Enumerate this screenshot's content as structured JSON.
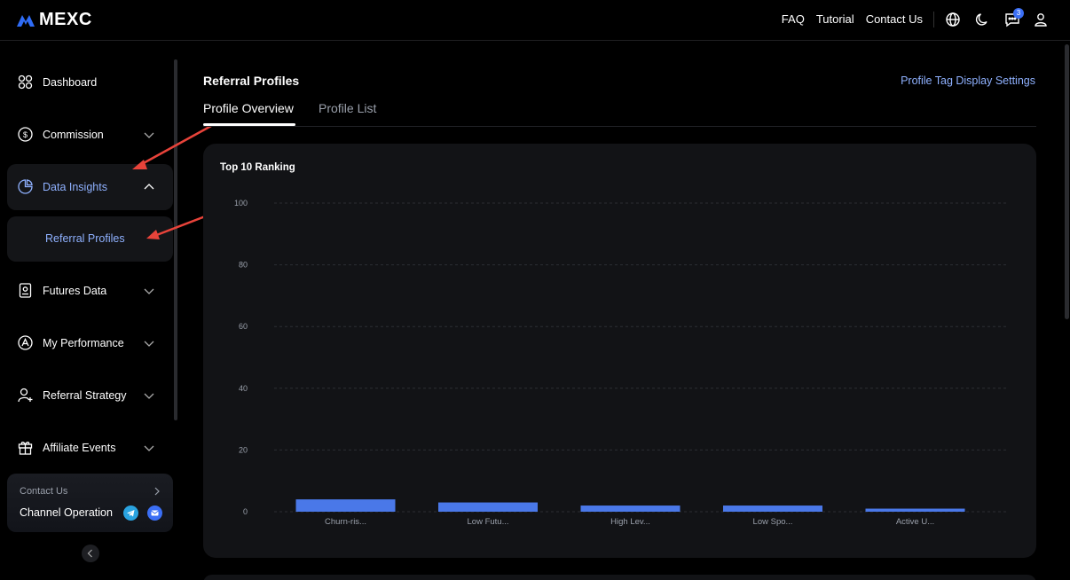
{
  "brand": {
    "name": "MEXC"
  },
  "header": {
    "links": [
      "FAQ",
      "Tutorial",
      "Contact Us"
    ],
    "message_badge_count": "3"
  },
  "sidebar": {
    "items": [
      {
        "label": "Dashboard",
        "icon": "dashboard-icon"
      },
      {
        "label": "Commission",
        "icon": "dollar-circle-icon"
      },
      {
        "label": "Data Insights",
        "icon": "pie-chart-icon"
      },
      {
        "label": "Futures Data",
        "icon": "futures-icon"
      },
      {
        "label": "My Performance",
        "icon": "performance-icon"
      },
      {
        "label": "Referral Strategy",
        "icon": "user-plus-icon"
      },
      {
        "label": "Affiliate Events",
        "icon": "gift-icon"
      }
    ],
    "sub_item": "Referral Profiles",
    "contact_card": {
      "title": "Contact Us",
      "subtitle": "Channel Operation"
    }
  },
  "main": {
    "title": "Referral Profiles",
    "tag_settings_link": "Profile Tag Display Settings",
    "tabs": [
      "Profile Overview",
      "Profile List"
    ]
  },
  "chart_data": {
    "type": "bar",
    "title": "Top 10 Ranking",
    "categories": [
      "Churn-ris...",
      "Low Futu...",
      "High Lev...",
      "Low Spo...",
      "Active U..."
    ],
    "values": [
      4,
      3,
      2,
      2,
      1
    ],
    "ylim": [
      0,
      100
    ],
    "yticks": [
      0,
      20,
      40,
      60,
      80,
      100
    ],
    "grid": true,
    "bar_color": "#4a78e8"
  },
  "colors": {
    "accent": "#8fb1ff",
    "background": "#000000",
    "card": "#121316"
  }
}
